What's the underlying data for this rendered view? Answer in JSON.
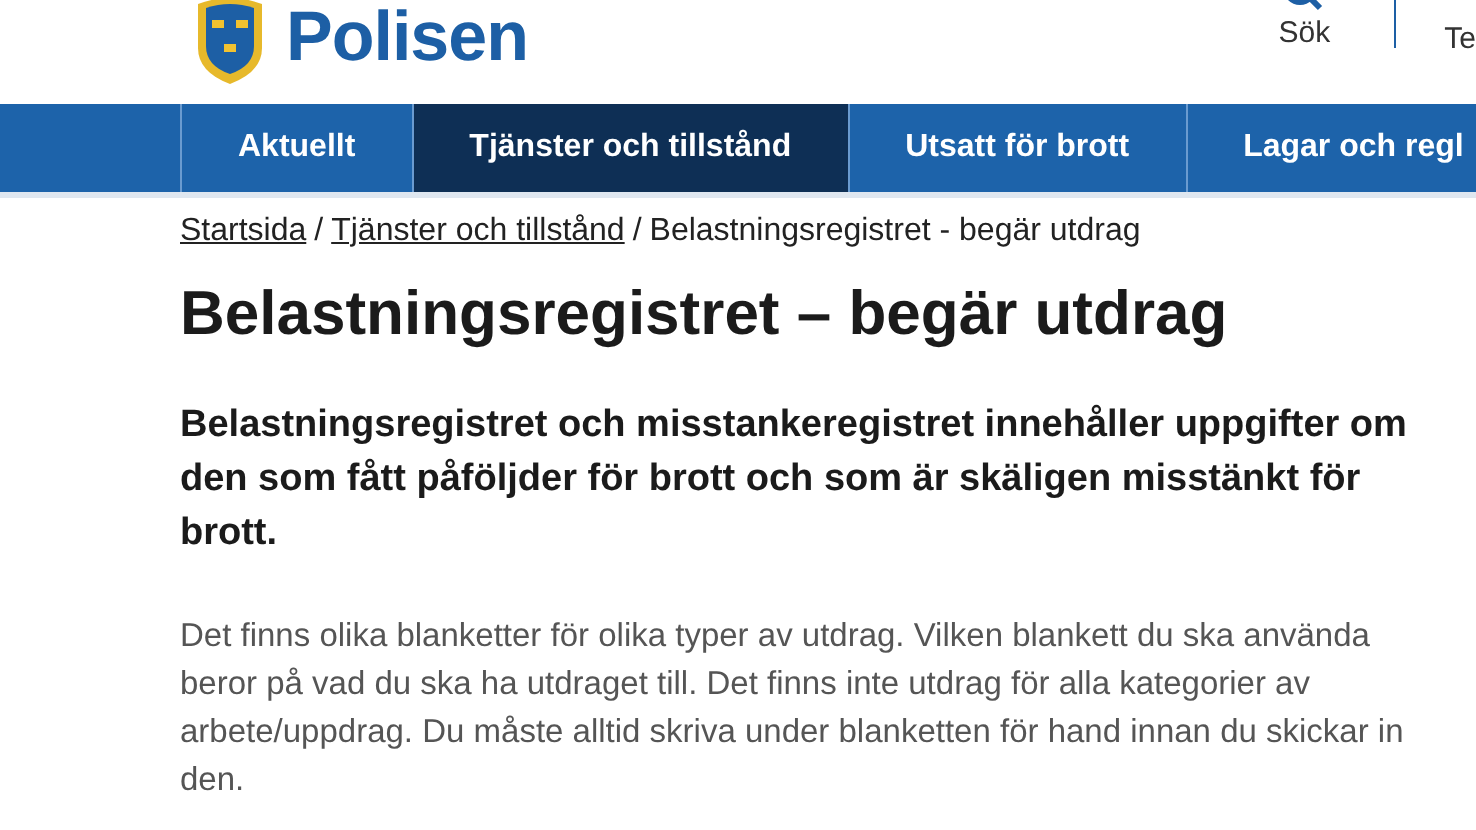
{
  "header": {
    "logo_text": "Polisen",
    "search": {
      "label": "Sök"
    },
    "cut_item": "Te"
  },
  "nav": [
    {
      "label": "Aktuellt",
      "selected": false
    },
    {
      "label": "Tjänster och tillstånd",
      "selected": true
    },
    {
      "label": "Utsatt för brott",
      "selected": false
    },
    {
      "label": "Lagar och regl",
      "selected": false
    }
  ],
  "breadcrumbs": {
    "links": [
      "Startsida",
      "Tjänster och tillstånd"
    ],
    "separator": "/",
    "current": "Belastningsregistret - begär utdrag"
  },
  "title": "Belastningsregistret – begär utdrag",
  "lead": "Belastningsregistret och misstankeregistret innehåller uppgifter om den som fått påföljder för brott och som är skäligen misstänkt för brott.",
  "body": "Det finns olika blanketter för olika typer av utdrag. Vilken blankett du ska använda beror på vad du ska ha utdraget till. Det finns inte utdrag för alla kategorier av arbete/uppdrag. Du måste alltid skriva under blanketten för hand innan du skickar in den."
}
